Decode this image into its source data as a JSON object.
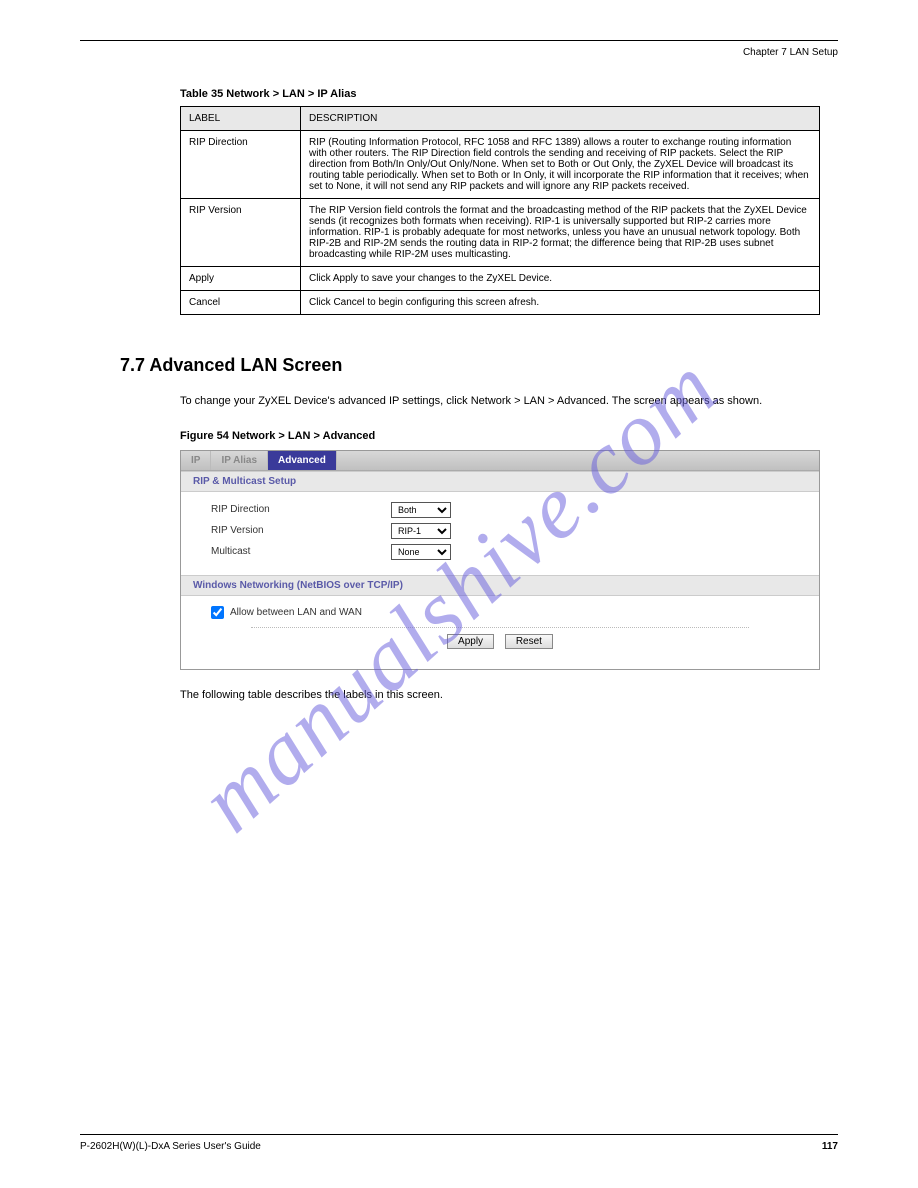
{
  "watermark": "manualshive.com",
  "header": "Chapter 7 LAN Setup",
  "table_caption": "Table 35   Network > LAN > IP Alias",
  "table": {
    "headers": [
      "LABEL",
      "DESCRIPTION"
    ],
    "rows": [
      {
        "label": "RIP Direction",
        "desc": "RIP (Routing Information Protocol, RFC 1058 and RFC 1389) allows a router to exchange routing information with other routers. The RIP Direction field controls the sending and receiving of RIP packets. Select the RIP direction from Both/In Only/Out Only/None. When set to Both or Out Only, the ZyXEL Device will broadcast its routing table periodically. When set to Both or In Only, it will incorporate the RIP information that it receives; when set to None, it will not send any RIP packets and will ignore any RIP packets received."
      },
      {
        "label": "RIP Version",
        "desc": "The RIP Version field controls the format and the broadcasting method of the RIP packets that the ZyXEL Device sends (it recognizes both formats when receiving). RIP-1 is universally supported but RIP-2 carries more information. RIP-1 is probably adequate for most networks, unless you have an unusual network topology. Both RIP-2B and RIP-2M sends the routing data in RIP-2 format; the difference being that RIP-2B uses subnet broadcasting while RIP-2M uses multicasting."
      },
      {
        "label": "Apply",
        "desc": "Click Apply to save your changes to the ZyXEL Device."
      },
      {
        "label": "Cancel",
        "desc": "Click Cancel to begin configuring this screen afresh."
      }
    ]
  },
  "section_heading": "7.7  Advanced LAN Screen",
  "body_paragraph": "To change your ZyXEL Device's advanced IP settings, click Network > LAN > Advanced. The screen appears as shown.",
  "figure_caption": "Figure 54   Network > LAN > Advanced",
  "ui": {
    "tabs": [
      "IP",
      "IP Alias",
      "Advanced"
    ],
    "active_tab_index": 2,
    "section1_title": "RIP & Multicast Setup",
    "fields": [
      {
        "label": "RIP Direction",
        "value": "Both"
      },
      {
        "label": "RIP Version",
        "value": "RIP-1"
      },
      {
        "label": "Multicast",
        "value": "None"
      }
    ],
    "section2_title": "Windows Networking (NetBIOS over TCP/IP)",
    "checkbox_label": "Allow between LAN and WAN",
    "checkbox_checked": true,
    "buttons": {
      "apply": "Apply",
      "reset": "Reset"
    }
  },
  "body_paragraph2": "The following table describes the labels in this screen.",
  "footer": {
    "left": "P-2602H(W)(L)-DxA Series User's Guide",
    "right": "117"
  }
}
